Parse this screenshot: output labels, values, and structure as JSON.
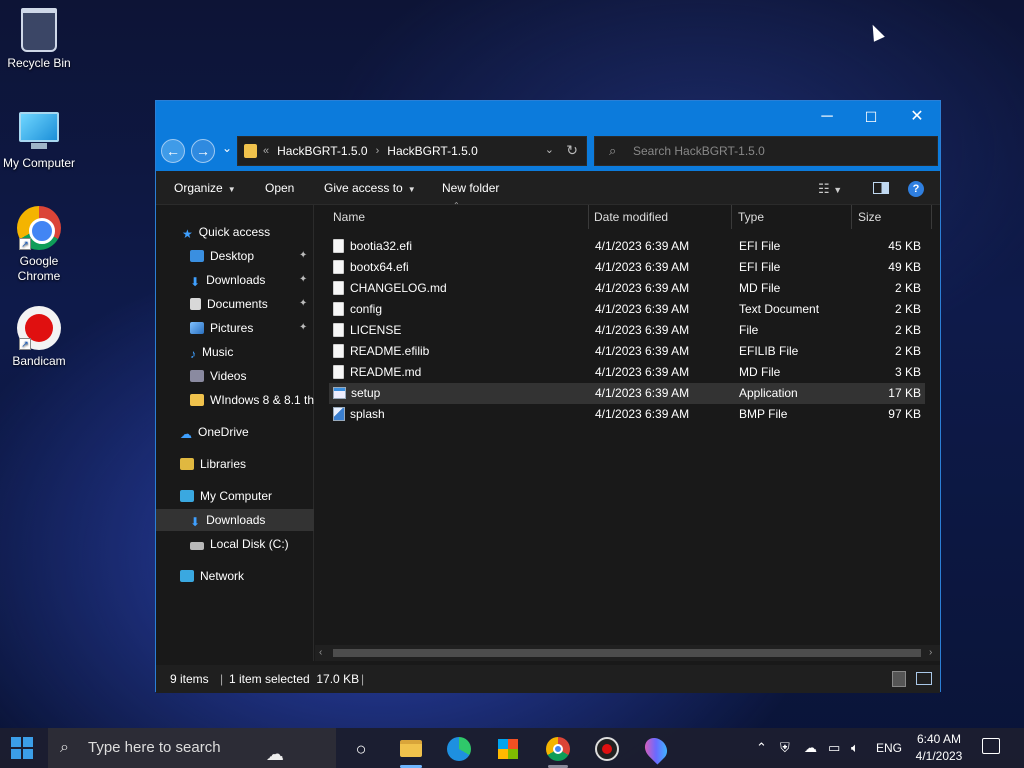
{
  "desktop": {
    "icons": [
      {
        "label": "Recycle Bin"
      },
      {
        "label": "My Computer"
      },
      {
        "label": "Google Chrome"
      },
      {
        "label": "Bandicam"
      }
    ]
  },
  "window": {
    "controls": {
      "minimize": "─",
      "maximize": "☐",
      "close": "✕"
    },
    "nav": {
      "back": "←",
      "forward": "→",
      "recent": "⌄"
    },
    "address": {
      "prefix": "«",
      "crumbs": [
        "HackBGRT-1.5.0",
        "HackBGRT-1.5.0"
      ],
      "separator": "›",
      "dropdown": "⌄",
      "refresh": "↻"
    },
    "search": {
      "placeholder": "Search HackBGRT-1.5.0"
    },
    "toolbar": {
      "organize": "Organize",
      "open": "Open",
      "give_access": "Give access to",
      "new_folder": "New folder",
      "help": "?"
    },
    "navpane": {
      "items": [
        {
          "label": "Quick access"
        },
        {
          "label": "Desktop"
        },
        {
          "label": "Downloads"
        },
        {
          "label": "Documents"
        },
        {
          "label": "Pictures"
        },
        {
          "label": "Music"
        },
        {
          "label": "Videos"
        },
        {
          "label": "WIndows 8 & 8.1 th"
        },
        {
          "label": "OneDrive"
        },
        {
          "label": "Libraries"
        },
        {
          "label": "My Computer"
        },
        {
          "label": "Downloads"
        },
        {
          "label": "Local Disk (C:)"
        },
        {
          "label": "Network"
        }
      ],
      "pin": "📌"
    },
    "columns": {
      "name": "Name",
      "date": "Date modified",
      "type": "Type",
      "size": "Size"
    },
    "files": [
      {
        "name": "bootia32.efi",
        "date": "4/1/2023 6:39 AM",
        "type": "EFI File",
        "size": "45 KB",
        "icon": "file-icon"
      },
      {
        "name": "bootx64.efi",
        "date": "4/1/2023 6:39 AM",
        "type": "EFI File",
        "size": "49 KB",
        "icon": "file-icon"
      },
      {
        "name": "CHANGELOG.md",
        "date": "4/1/2023 6:39 AM",
        "type": "MD File",
        "size": "2 KB",
        "icon": "file-icon"
      },
      {
        "name": "config",
        "date": "4/1/2023 6:39 AM",
        "type": "Text Document",
        "size": "2 KB",
        "icon": "text-file-icon"
      },
      {
        "name": "LICENSE",
        "date": "4/1/2023 6:39 AM",
        "type": "File",
        "size": "2 KB",
        "icon": "file-icon"
      },
      {
        "name": "README.efilib",
        "date": "4/1/2023 6:39 AM",
        "type": "EFILIB File",
        "size": "2 KB",
        "icon": "file-icon"
      },
      {
        "name": "README.md",
        "date": "4/1/2023 6:39 AM",
        "type": "MD File",
        "size": "3 KB",
        "icon": "file-icon"
      },
      {
        "name": "setup",
        "date": "4/1/2023 6:39 AM",
        "type": "Application",
        "size": "17 KB",
        "icon": "application-icon",
        "selected": true
      },
      {
        "name": "splash",
        "date": "4/1/2023 6:39 AM",
        "type": "BMP File",
        "size": "97 KB",
        "icon": "bmp-file-icon"
      }
    ],
    "status": {
      "items": "9 items",
      "selected": "1 item selected  17.0 KB",
      "sep": "|"
    }
  },
  "taskbar": {
    "search_placeholder": "Type here to search",
    "tray": {
      "language": "ENG",
      "time": "6:40 AM",
      "date": "4/1/2023"
    }
  },
  "colors": {
    "accent": "#0c7bdc",
    "window_bg": "#191919",
    "selection": "#333333"
  }
}
